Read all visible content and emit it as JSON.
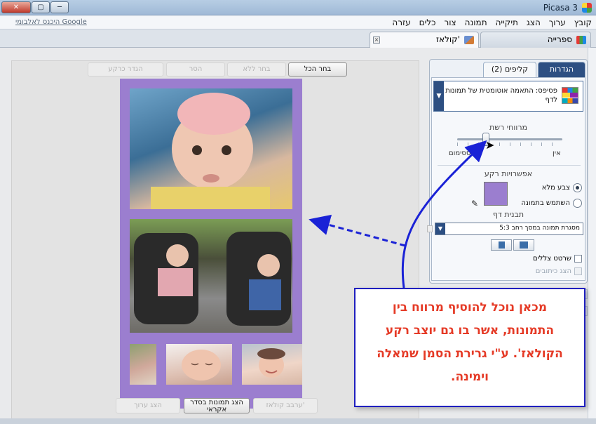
{
  "window": {
    "title": "Picasa 3",
    "close_label": "✕",
    "maximize_label": "▢",
    "minimize_label": "─"
  },
  "menu": {
    "items": [
      "קובץ",
      "ערוך",
      "הצג",
      "תיקייה",
      "תמונה",
      "צור",
      "כלים",
      "עזרה"
    ],
    "signin": "היכנס לאלבומי Google"
  },
  "tabs": {
    "library": "ספרייה",
    "collage": "קולאז'",
    "close_symbol": "×"
  },
  "toolbar_top": {
    "select_all": "בחר הכל",
    "clear_selection": "בחר ללא",
    "remove": "הסר",
    "set_background": "הגדר כרקע"
  },
  "toolbar_bottom": {
    "edit_collage": "ערבב קולאז'",
    "shuffle": "הצג תמונות בסדר אקראי",
    "show_edit": "הצג ערוך"
  },
  "panel": {
    "tab_settings": "הגדרות",
    "tab_clips": "קליפים (2)",
    "layout_label": "פסיפס: התאמה אוטומטית של תמונות לדף",
    "layout_drop_symbol": "▼",
    "grid_spacing_label": "מרווחי רשת",
    "slider_min": "אין",
    "slider_max": "ססימום",
    "grid_spacing_value": 0.25,
    "background_options_label": "אפשרויות רקע",
    "solid_color": "צבע מלא",
    "use_image": "השתמש בתמונה",
    "background_color": "#9b7ecf",
    "page_format_label": "תבנית דף",
    "page_format_value": "5:3 מסגרת תמונה במסך רחב",
    "shadows_label": "שרטט צללים",
    "captions_label": "הצג כיתובים"
  },
  "callout": {
    "text": "מכאן נוכל להוסיף מרווח בין התמונות, אשר בו גם יוצב רקע הקולאז'. ע\"י גרירת הסמן שמאלה וימינה."
  },
  "colors": {
    "accent": "#2d4f82",
    "callout_border": "#1f1fbf",
    "callout_text": "#e53a26",
    "arrow": "#1a22d6"
  },
  "icons": {
    "mosaic": "mosaic-icon",
    "cursor": "mouse-pointer-icon",
    "eyedropper": "eyedropper-icon"
  }
}
